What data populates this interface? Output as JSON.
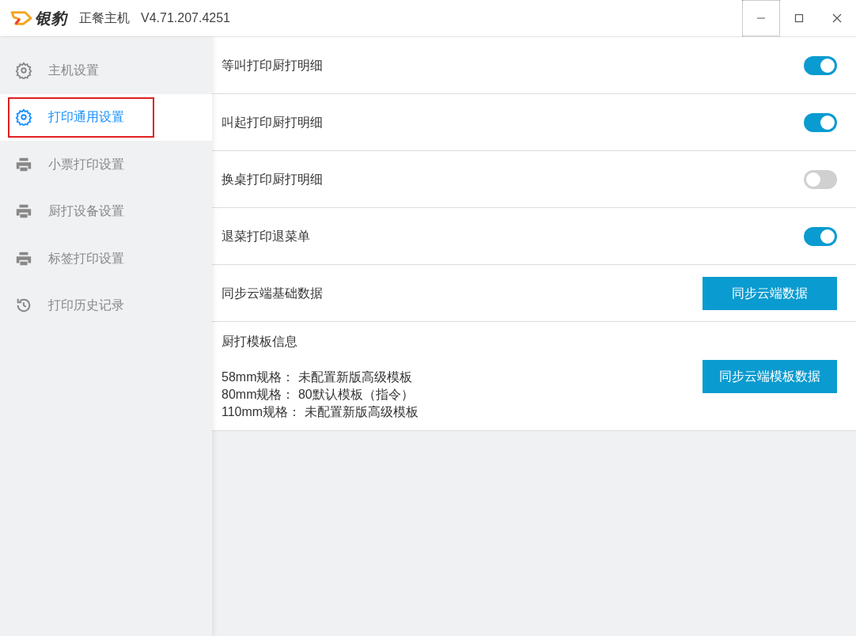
{
  "window": {
    "logo": "银豹",
    "title": "正餐主机",
    "version": "V4.71.207.4251"
  },
  "sidebar": {
    "items": [
      {
        "kind": "gear",
        "label": "主机设置",
        "selected": false
      },
      {
        "kind": "gear",
        "label": "打印通用设置",
        "selected": true
      },
      {
        "kind": "printer",
        "label": "小票打印设置",
        "selected": false
      },
      {
        "kind": "printer",
        "label": "厨打设备设置",
        "selected": false
      },
      {
        "kind": "printer",
        "label": "标签打印设置",
        "selected": false
      },
      {
        "kind": "history",
        "label": "打印历史记录",
        "selected": false
      }
    ]
  },
  "settings": [
    {
      "kind": "toggle",
      "label": "等叫打印厨打明细",
      "on": true
    },
    {
      "kind": "toggle",
      "label": "叫起打印厨打明细",
      "on": true
    },
    {
      "kind": "toggle",
      "label": "换桌打印厨打明细",
      "on": false
    },
    {
      "kind": "toggle",
      "label": "退菜打印退菜单",
      "on": true
    },
    {
      "kind": "button",
      "label": "同步云端基础数据",
      "button": "同步云端数据"
    },
    {
      "kind": "template",
      "label": "厨打模板信息",
      "lines": [
        {
          "spec": "58mm规格：",
          "value": "未配置新版高级模板"
        },
        {
          "spec": "80mm规格：",
          "value": "80默认模板（指令）"
        },
        {
          "spec": "110mm规格：",
          "value": "未配置新版高级模板"
        }
      ],
      "button": "同步云端模板数据"
    }
  ]
}
